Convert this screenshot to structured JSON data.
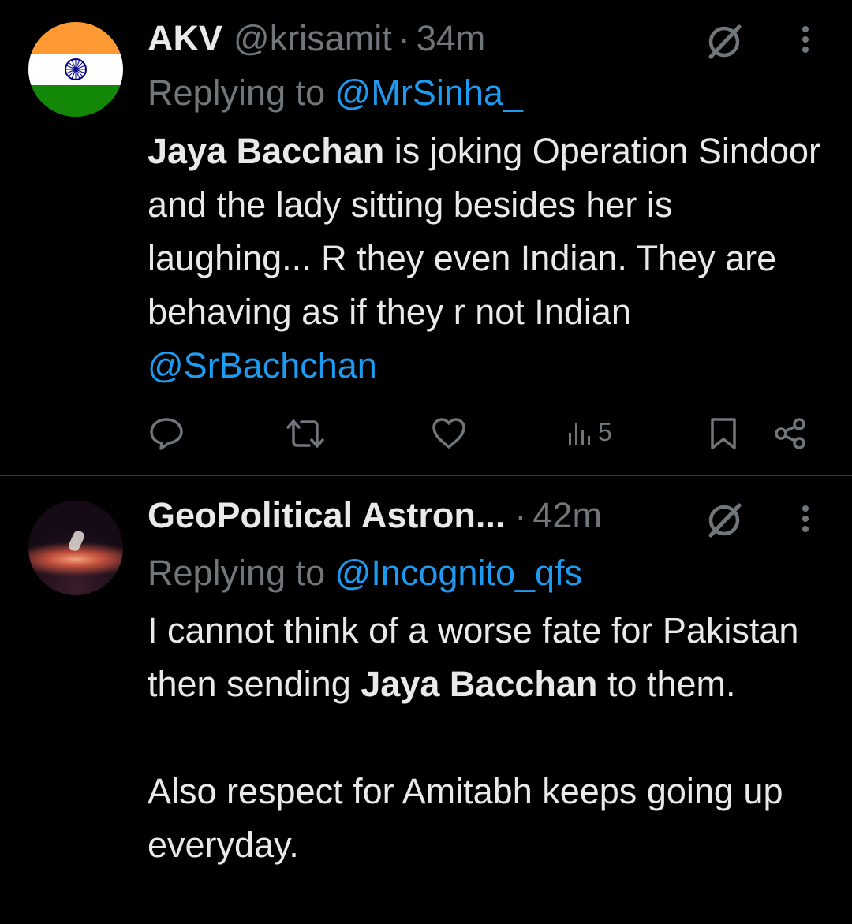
{
  "tweets": [
    {
      "author_name": "AKV",
      "handle": "@krisamit",
      "separator": "·",
      "time": "34m",
      "replying_to_label": "Replying to",
      "replying_to_handle": "@MrSinha_",
      "avatar": "india-flag-avatar",
      "body": {
        "bold_1": "Jaya Bacchan",
        "text_1": " is joking Operation Sindoor and the lady sitting besides her is laughing... R they even Indian. They are behaving as if they r not Indian ",
        "mention": "@SrBachchan"
      },
      "metrics": {
        "views": "5"
      },
      "icons": [
        "grok-icon",
        "more-icon",
        "reply-icon",
        "retweet-icon",
        "like-icon",
        "views-icon",
        "bookmark-icon",
        "share-icon"
      ]
    },
    {
      "author_name": "GeoPolitical Astron...",
      "separator": "·",
      "time": "42m",
      "replying_to_label": "Replying to",
      "replying_to_handle": "@Incognito_qfs",
      "avatar": "astronaut-space-avatar",
      "body": {
        "text_1": "I cannot think of a worse fate for Pakistan then sending ",
        "bold_1": "Jaya Bacchan",
        "text_2": " to them.",
        "paragraph_2": "Also respect for Amitabh keeps going up everyday."
      }
    }
  ],
  "colors": {
    "background": "#000000",
    "text": "#e7e9ea",
    "muted": "#71767b",
    "link": "#1d9bf0",
    "divider": "#2f3336"
  }
}
